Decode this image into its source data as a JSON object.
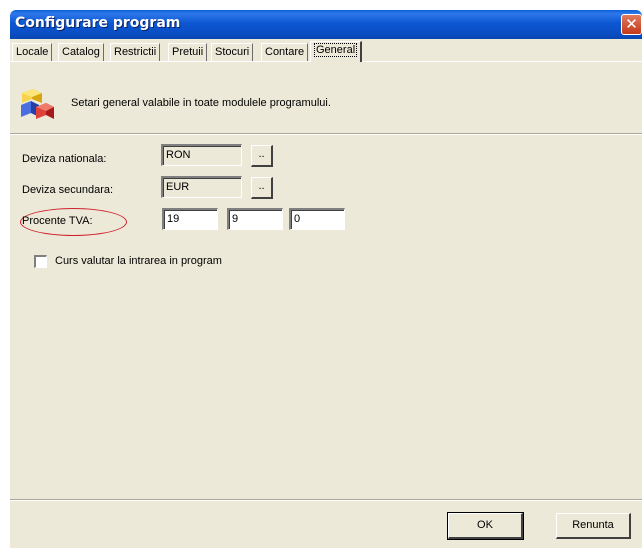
{
  "window": {
    "title": "Configurare program",
    "close_icon": "close-icon"
  },
  "tabs": [
    {
      "label": "Locale"
    },
    {
      "label": "Catalog"
    },
    {
      "label": "Restrictii"
    },
    {
      "label": "Pretuii"
    },
    {
      "label": "Stocuri"
    },
    {
      "label": "Contare"
    },
    {
      "label": "General",
      "active": true
    }
  ],
  "header": {
    "icon": "cubes-icon",
    "text": "Setari general valabile in toate modulele programului."
  },
  "fields": {
    "currency_national": {
      "label": "Deviza nationala:",
      "value": "RON",
      "button": ".."
    },
    "currency_secondary": {
      "label": "Deviza secundara:",
      "value": "EUR",
      "button": ".."
    },
    "vat": {
      "label": "Procente TVA:",
      "values": [
        "19",
        "9",
        "0"
      ]
    }
  },
  "checkbox": {
    "label": "Curs valutar la intrarea in program",
    "checked": false
  },
  "buttons": {
    "ok": "OK",
    "cancel": "Renunta"
  },
  "colors": {
    "title_bar": "#0a5fd8",
    "highlight": "#d0202e",
    "dialog_bg": "#ece9d8"
  }
}
